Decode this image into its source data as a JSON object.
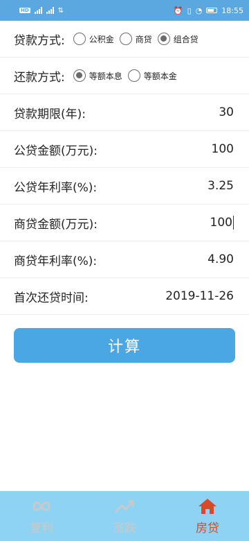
{
  "status_bar": {
    "left_chip": "HD",
    "right_icons": [
      "alarm-icon",
      "vibrate-icon",
      "wifi-icon",
      "battery-icon"
    ],
    "time": "18:55"
  },
  "form": {
    "loan_type": {
      "label": "贷款方式:",
      "options": [
        {
          "label": "公积金",
          "checked": false
        },
        {
          "label": "商贷",
          "checked": false
        },
        {
          "label": "组合贷",
          "checked": true
        }
      ]
    },
    "repay_method": {
      "label": "还款方式:",
      "options": [
        {
          "label": "等额本息",
          "checked": true
        },
        {
          "label": "等额本金",
          "checked": false
        }
      ]
    },
    "term": {
      "label": "贷款期限(年):",
      "value": "30"
    },
    "provident_amount": {
      "label": "公贷金额(万元):",
      "value": "100"
    },
    "provident_rate": {
      "label": "公贷年利率(%):",
      "value": "3.25"
    },
    "commercial_amount": {
      "label": "商贷金额(万元):",
      "value": "100"
    },
    "commercial_rate": {
      "label": "商贷年利率(%):",
      "value": "4.90"
    },
    "first_payment": {
      "label": "首次还贷时间:",
      "value": "2019-11-26"
    }
  },
  "calculate_button": "计算",
  "bottom_nav": {
    "items": [
      {
        "label": "复利",
        "icon": "infinity-icon",
        "active": false
      },
      {
        "label": "涨跌",
        "icon": "trend-up-icon",
        "active": false
      },
      {
        "label": "房贷",
        "icon": "home-icon",
        "active": true
      }
    ]
  },
  "colors": {
    "status_bar": "#5aa8df",
    "button": "#4aa7e4",
    "bottom_nav": "#8fd3f4",
    "active_tab": "#d64a2a",
    "inactive_tab": "#c9c9c9"
  }
}
